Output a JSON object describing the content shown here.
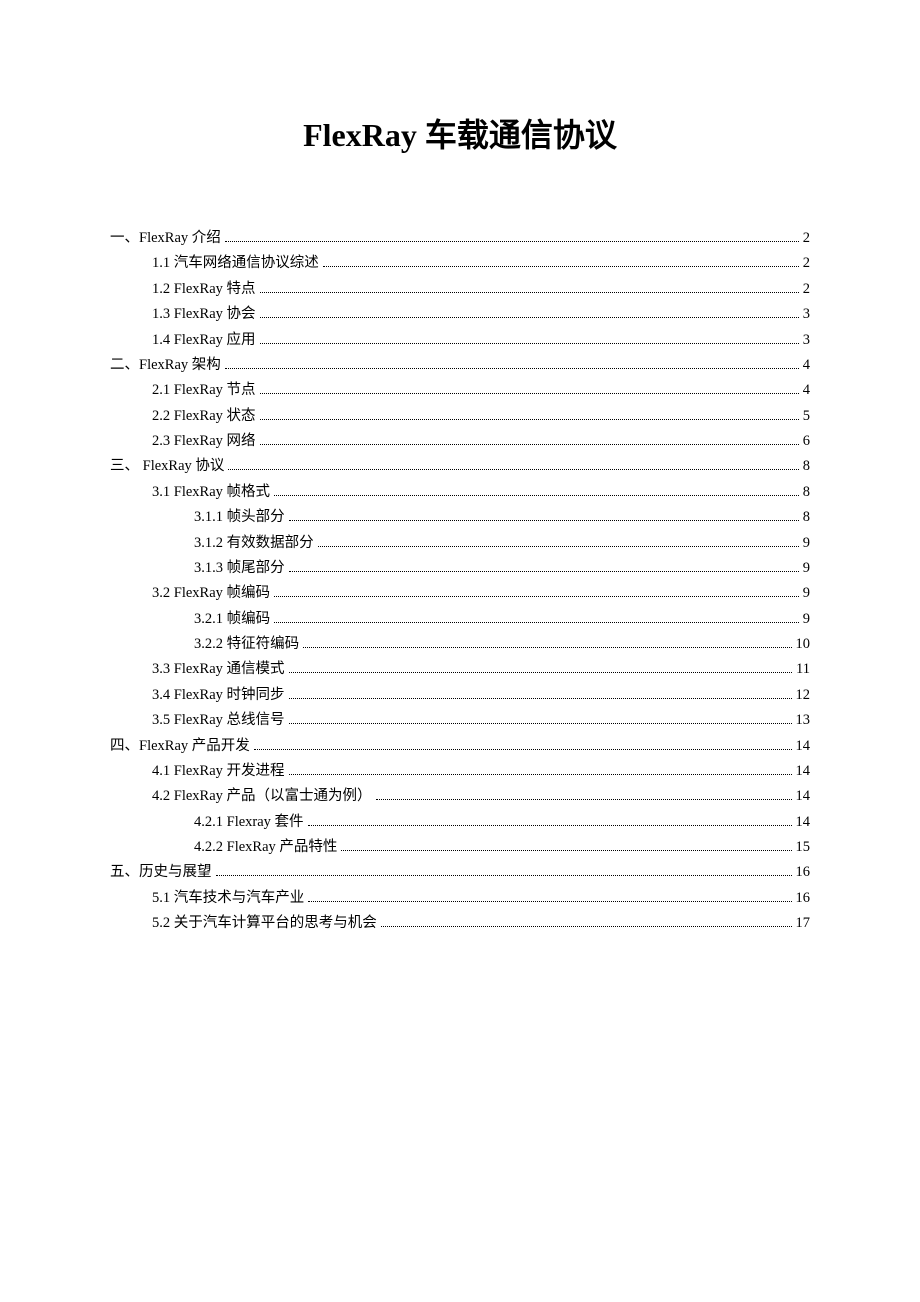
{
  "title": "FlexRay 车载通信协议",
  "toc": [
    {
      "level": 0,
      "label": "一、FlexRay 介绍",
      "page": "2"
    },
    {
      "level": 1,
      "label": "1.1 汽车网络通信协议综述",
      "page": "2"
    },
    {
      "level": 1,
      "label": "1.2 FlexRay 特点",
      "page": "2"
    },
    {
      "level": 1,
      "label": "1.3 FlexRay 协会",
      "page": "3"
    },
    {
      "level": 1,
      "label": "1.4 FlexRay 应用",
      "page": "3"
    },
    {
      "level": 0,
      "label": "二、FlexRay 架构",
      "page": "4"
    },
    {
      "level": 1,
      "label": "2.1 FlexRay 节点",
      "page": "4"
    },
    {
      "level": 1,
      "label": "2.2 FlexRay 状态",
      "page": "5"
    },
    {
      "level": 1,
      "label": "2.3 FlexRay 网络",
      "page": "6"
    },
    {
      "level": 0,
      "label": "三、 FlexRay 协议",
      "page": "8"
    },
    {
      "level": 1,
      "label": "3.1 FlexRay 帧格式",
      "page": "8"
    },
    {
      "level": 2,
      "label": "3.1.1 帧头部分",
      "page": "8"
    },
    {
      "level": 2,
      "label": "3.1.2 有效数据部分",
      "page": "9"
    },
    {
      "level": 2,
      "label": "3.1.3 帧尾部分",
      "page": "9"
    },
    {
      "level": 1,
      "label": "3.2 FlexRay 帧编码",
      "page": "9"
    },
    {
      "level": 2,
      "label": "3.2.1 帧编码",
      "page": "9"
    },
    {
      "level": 2,
      "label": "3.2.2 特征符编码",
      "page": "10"
    },
    {
      "level": 1,
      "label": "3.3 FlexRay 通信模式",
      "page": "11"
    },
    {
      "level": 1,
      "label": "3.4 FlexRay 时钟同步",
      "page": "12"
    },
    {
      "level": 1,
      "label": "3.5 FlexRay 总线信号",
      "page": "13"
    },
    {
      "level": 0,
      "label": "四、FlexRay 产品开发",
      "page": "14"
    },
    {
      "level": 1,
      "label": "4.1 FlexRay 开发进程",
      "page": "14"
    },
    {
      "level": 1,
      "label": "4.2 FlexRay 产品（以富士通为例）",
      "page": "14"
    },
    {
      "level": 2,
      "label": "4.2.1 Flexray 套件",
      "page": "14"
    },
    {
      "level": 2,
      "label": "4.2.2 FlexRay 产品特性",
      "page": "15"
    },
    {
      "level": 0,
      "label": "五、历史与展望",
      "page": "16"
    },
    {
      "level": 1,
      "label": "5.1 汽车技术与汽车产业",
      "page": "16"
    },
    {
      "level": 1,
      "label": "5.2 关于汽车计算平台的思考与机会",
      "page": "17"
    }
  ]
}
